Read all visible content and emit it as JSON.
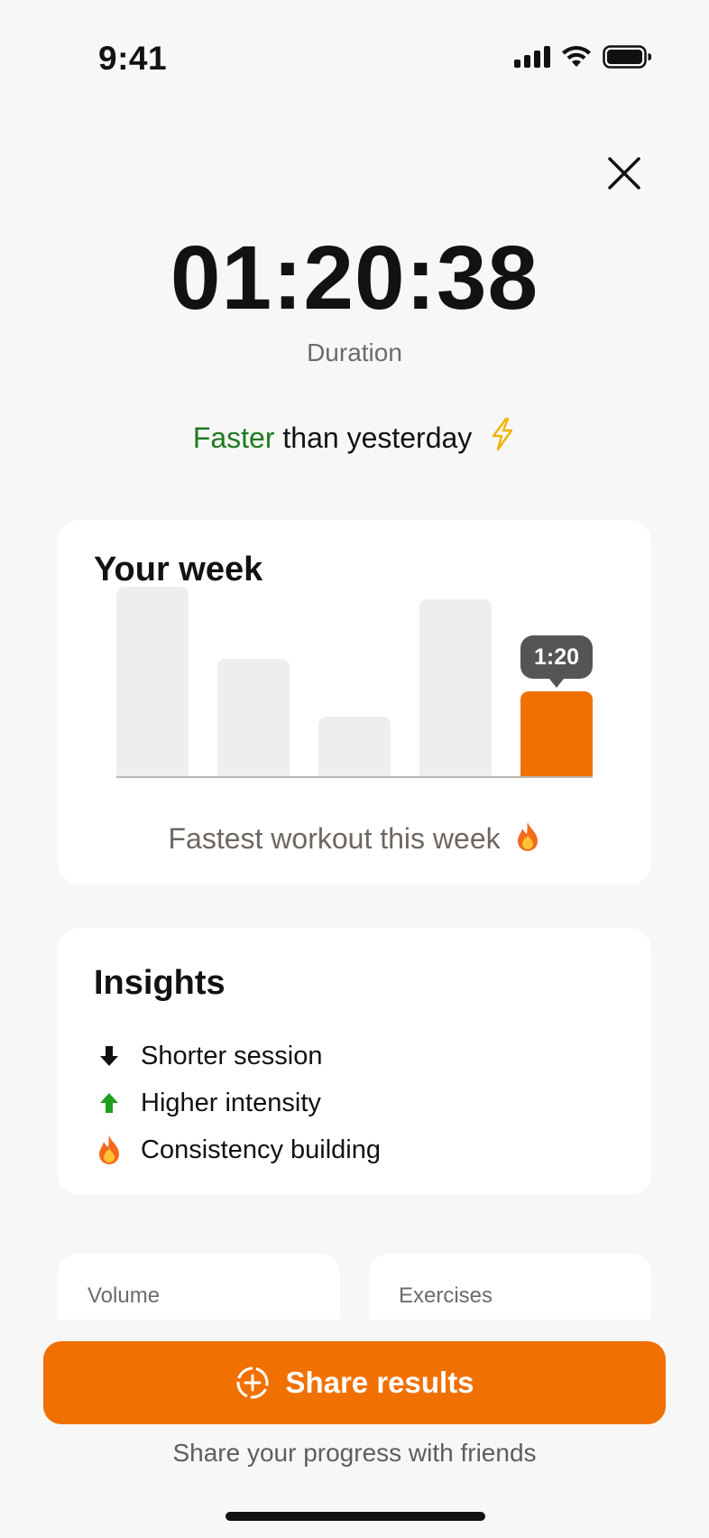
{
  "status_bar": {
    "time": "9:41",
    "icons": [
      "signal-icon",
      "wifi-icon",
      "battery-icon"
    ]
  },
  "header": {
    "close_icon": "close-icon"
  },
  "duration": {
    "value": "01:20:38",
    "label": "Duration"
  },
  "comparison": {
    "highlight": "Faster",
    "rest": " than yesterday",
    "icon": "lightning-icon",
    "highlight_color": "#1f7a1f"
  },
  "week_card": {
    "title": "Your week",
    "caption": "Fastest workout this week",
    "caption_icon": "fire-icon"
  },
  "chart_data": {
    "type": "bar",
    "categories": [
      "1",
      "2",
      "3",
      "4",
      "5"
    ],
    "values": [
      1.5,
      0.93,
      0.47,
      1.4,
      0.67
    ],
    "highlight_index": 4,
    "highlight_label": "1:20",
    "ylim": [
      0,
      1.6
    ],
    "colors": {
      "bar": "#efeeec",
      "highlight": "#f07102"
    }
  },
  "insights": {
    "title": "Insights",
    "items": [
      {
        "icon": "arrow-down-icon",
        "label": "Shorter session"
      },
      {
        "icon": "arrow-up-icon",
        "label": "Higher intensity",
        "color": "#1f9e1f"
      },
      {
        "icon": "fire-icon",
        "label": "Consistency building"
      }
    ]
  },
  "stats": {
    "volume_label": "Volume",
    "exercises_label": "Exercises"
  },
  "share": {
    "button_label": "Share results",
    "button_icon": "add-circle-icon",
    "subtitle": "Share your progress with friends",
    "accent": "#f07102"
  }
}
